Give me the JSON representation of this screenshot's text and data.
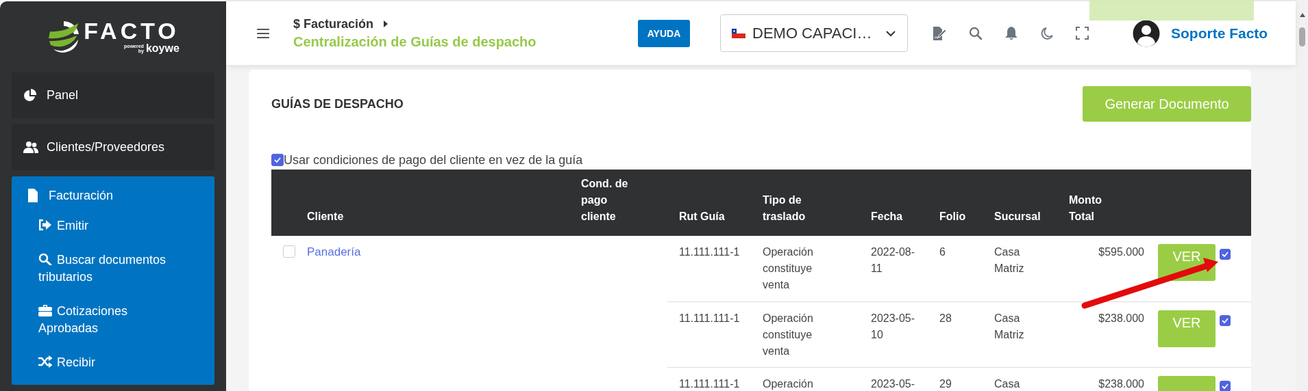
{
  "logo": {
    "name": "FACTO",
    "powered": "powered",
    "by": "by",
    "brand": "koywe"
  },
  "sidebar": {
    "items": [
      {
        "label": "Panel",
        "selected": false
      },
      {
        "label": "Clientes/Proveedores",
        "selected": false
      },
      {
        "label": "Facturación",
        "selected": true,
        "expanded": true,
        "children": [
          {
            "label": "Emitir"
          },
          {
            "label": "Buscar documentos tributarios"
          },
          {
            "label": "Cotizaciones Aprobadas"
          },
          {
            "label": "Recibir"
          }
        ]
      }
    ]
  },
  "header": {
    "breadcrumb": {
      "section": "$ Facturación",
      "page": "Centralización de Guías de despacho"
    },
    "help_button": "AYUDA",
    "company_select": {
      "value": "DEMO CAPACI…"
    },
    "user": "Soporte Facto"
  },
  "card": {
    "title": "GUÍAS DE DESPACHO",
    "primary_button": "Generar Documento",
    "option": {
      "label": "Usar condiciones de pago del cliente en vez de la guía",
      "checked": true
    }
  },
  "table": {
    "columns": [
      "Cliente",
      "Cond. de pago cliente",
      "Rut Guía",
      "Tipo de traslado",
      "Fecha",
      "Folio",
      "Sucursal",
      "Monto Total"
    ],
    "groups": [
      {
        "client": "Panadería",
        "selected": false,
        "guides": [
          {
            "rut": "11.111.111-1",
            "tipo": "Operación constituye venta",
            "fecha": "2022-08-11",
            "folio": "6",
            "sucursal": "Casa Matriz",
            "monto": "$595.000",
            "button": "VER",
            "checked": true
          },
          {
            "rut": "11.111.111-1",
            "tipo": "Operación constituye venta",
            "fecha": "2023-05-10",
            "folio": "28",
            "sucursal": "Casa Matriz",
            "monto": "$238.000",
            "button": "VER",
            "checked": true
          },
          {
            "rut": "11.111.111-1",
            "tipo": "Operación",
            "fecha": "2023-05-",
            "folio": "29",
            "sucursal": "Casa",
            "monto": "$238.000",
            "checked": true
          }
        ]
      }
    ]
  }
}
